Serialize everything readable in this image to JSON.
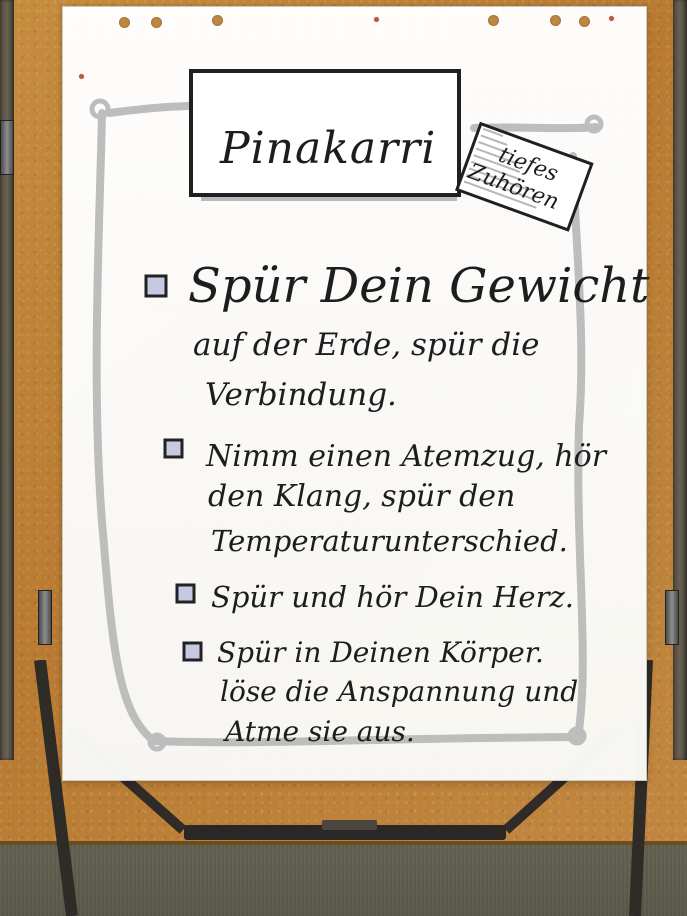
{
  "image": {
    "title": "Pinakarri",
    "sticker": {
      "line1": "tiefes",
      "line2": "Zuhören"
    },
    "items": [
      {
        "lines": [
          "Spür Dein Gewicht",
          "auf der Erde, spür die",
          "Verbindung."
        ]
      },
      {
        "lines": [
          "Nimm einen Atemzug, hör",
          "den Klang, spür den",
          "Temperaturunterschied."
        ]
      },
      {
        "lines": [
          "Spür und hör Dein Herz."
        ]
      },
      {
        "lines": [
          "Spür in Deinen Körper.",
          "löse die Anspannung und",
          "Atme sie aus."
        ]
      }
    ],
    "colors": {
      "paper": "#f8f8f5",
      "cork": "#c18740",
      "ink": "#1d1d1d",
      "checkbox_fill": "#c7c9e2",
      "frame_gray": "#bdbdbd",
      "pin_red": "#c7543a"
    },
    "icons": {
      "checkbox": "checkbox-icon",
      "rope": "rope-frame-icon",
      "pin": "pin-icon"
    }
  }
}
